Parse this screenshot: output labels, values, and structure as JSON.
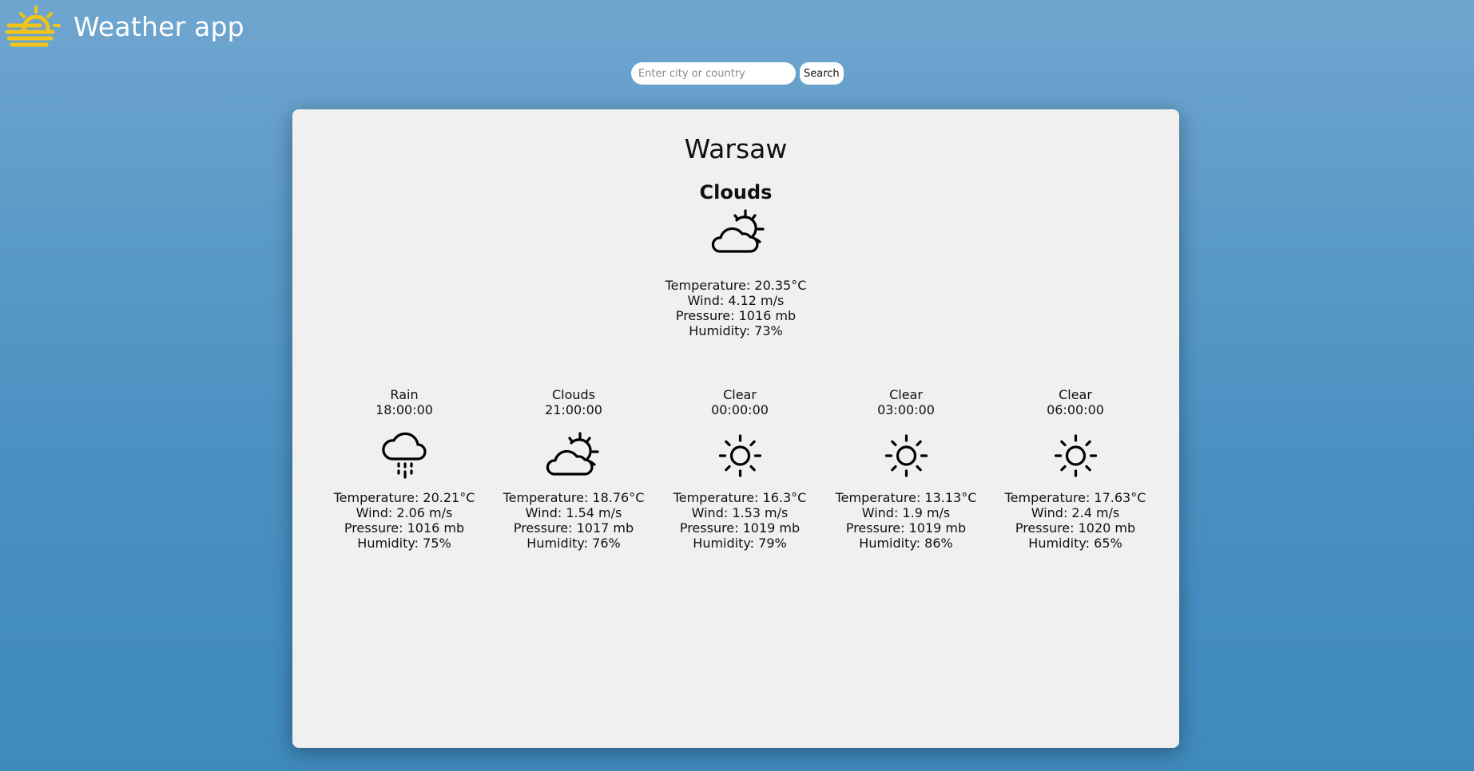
{
  "header": {
    "title": "Weather app",
    "logo_icon": "sun-over-horizon-icon",
    "logo_color": "#f2c418"
  },
  "search": {
    "placeholder": "Enter city or country",
    "value": "",
    "button_label": "Search"
  },
  "current": {
    "city": "Warsaw",
    "condition": "Clouds",
    "icon": "partly-cloudy-icon",
    "temperature": "Temperature: 20.35°C",
    "wind": "Wind: 4.12 m/s",
    "pressure": "Pressure: 1016 mb",
    "humidity": "Humidity: 73%"
  },
  "forecast": [
    {
      "condition": "Rain",
      "time": "18:00:00",
      "icon": "rain-cloud-icon",
      "temperature": "Temperature: 20.21°C",
      "wind": "Wind: 2.06 m/s",
      "pressure": "Pressure: 1016 mb",
      "humidity": "Humidity: 75%"
    },
    {
      "condition": "Clouds",
      "time": "21:00:00",
      "icon": "partly-cloudy-icon",
      "temperature": "Temperature: 18.76°C",
      "wind": "Wind: 1.54 m/s",
      "pressure": "Pressure: 1017 mb",
      "humidity": "Humidity: 76%"
    },
    {
      "condition": "Clear",
      "time": "00:00:00",
      "icon": "sun-icon",
      "temperature": "Temperature: 16.3°C",
      "wind": "Wind: 1.53 m/s",
      "pressure": "Pressure: 1019 mb",
      "humidity": "Humidity: 79%"
    },
    {
      "condition": "Clear",
      "time": "03:00:00",
      "icon": "sun-icon",
      "temperature": "Temperature: 13.13°C",
      "wind": "Wind: 1.9 m/s",
      "pressure": "Pressure: 1019 mb",
      "humidity": "Humidity: 86%"
    },
    {
      "condition": "Clear",
      "time": "06:00:00",
      "icon": "sun-icon",
      "temperature": "Temperature: 17.63°C",
      "wind": "Wind: 2.4 m/s",
      "pressure": "Pressure: 1020 mb",
      "humidity": "Humidity: 65%"
    }
  ]
}
